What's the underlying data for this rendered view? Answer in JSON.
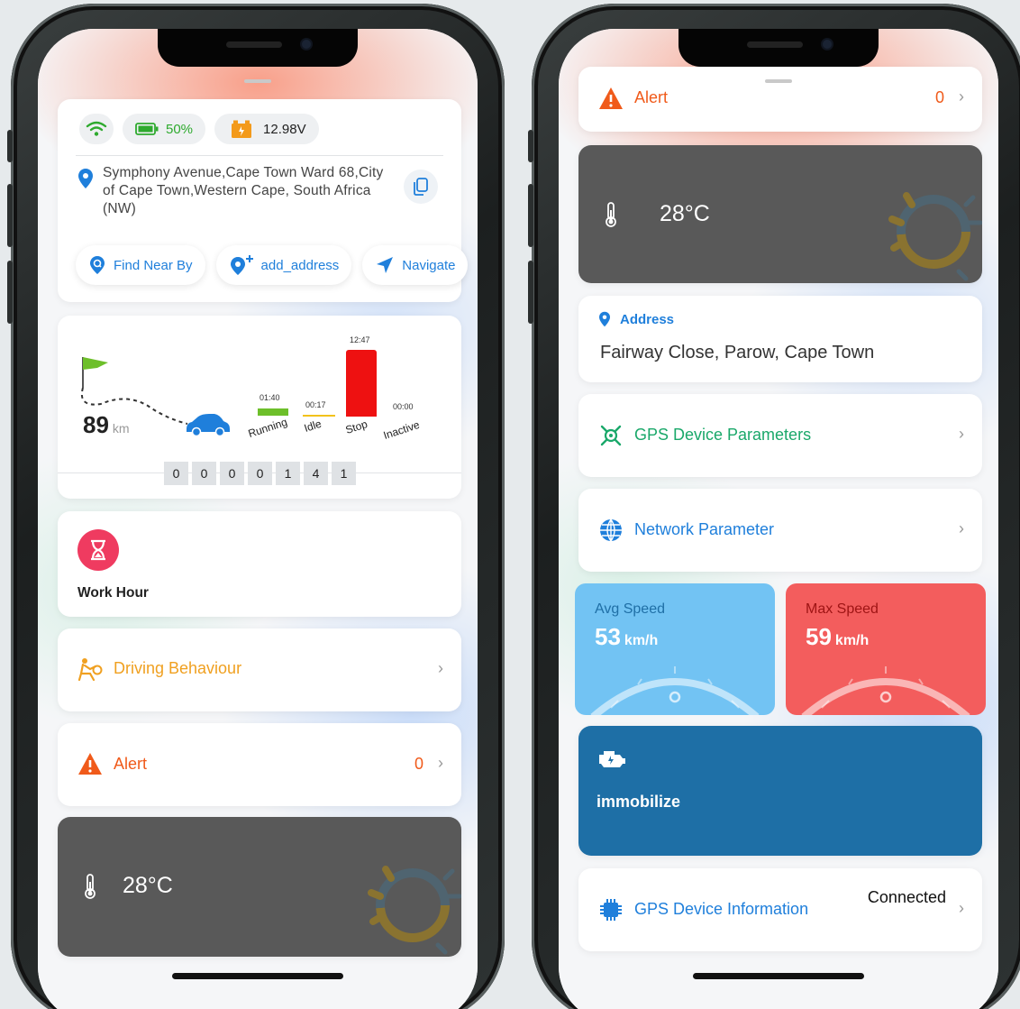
{
  "left_screen": {
    "status": {
      "battery_percent": "50%",
      "voltage": "12.98V"
    },
    "address": "Symphony Avenue,Cape Town Ward 68,City of Cape Town,Western Cape, South Africa (NW)",
    "actions": [
      {
        "label": "Find Near By",
        "icon": "search-pin-icon"
      },
      {
        "label": "add_address",
        "icon": "add-pin-icon"
      },
      {
        "label": "Navigate",
        "icon": "navigate-arrow-icon"
      }
    ],
    "trip": {
      "distance": "89",
      "distance_unit": "km",
      "states": [
        {
          "label": "Running",
          "time": "01:40",
          "color": "#6dbf2a"
        },
        {
          "label": "Idle",
          "time": "00:17",
          "color": "#f2c21b"
        },
        {
          "label": "Stop",
          "time": "12:47",
          "color": "#ee1111"
        },
        {
          "label": "Inactive",
          "time": "00:00",
          "color": "#9aa0a6"
        }
      ],
      "odometer": [
        "0",
        "0",
        "0",
        "0",
        "1",
        "4",
        "1"
      ]
    },
    "work_hour": {
      "label": "Work Hour"
    },
    "driving_behaviour": {
      "label": "Driving Behaviour",
      "color": "#f0a020"
    },
    "alert": {
      "label": "Alert",
      "count": "0",
      "color": "#f05a1a"
    },
    "temperature": {
      "value": "28°C"
    }
  },
  "right_screen": {
    "alert_partial": {
      "label": "Alert",
      "count": "0"
    },
    "temperature": {
      "value": "28°C"
    },
    "address": {
      "title": "Address",
      "value": "Fairway Close, Parow, Cape Town"
    },
    "gps_params": {
      "label": "GPS Device Parameters",
      "color": "#1aa86a"
    },
    "network": {
      "label": "Network Parameter",
      "color": "#1f7fdb"
    },
    "avg_speed": {
      "label": "Avg Speed",
      "value": "53",
      "unit": "km/h",
      "bg": "#72c3f3"
    },
    "max_speed": {
      "label": "Max Speed",
      "value": "59",
      "unit": "km/h",
      "bg": "#f35d5d"
    },
    "immobilize": {
      "label": "immobilize"
    },
    "gps_info": {
      "label": "GPS Device Information",
      "status": "Connected"
    }
  }
}
